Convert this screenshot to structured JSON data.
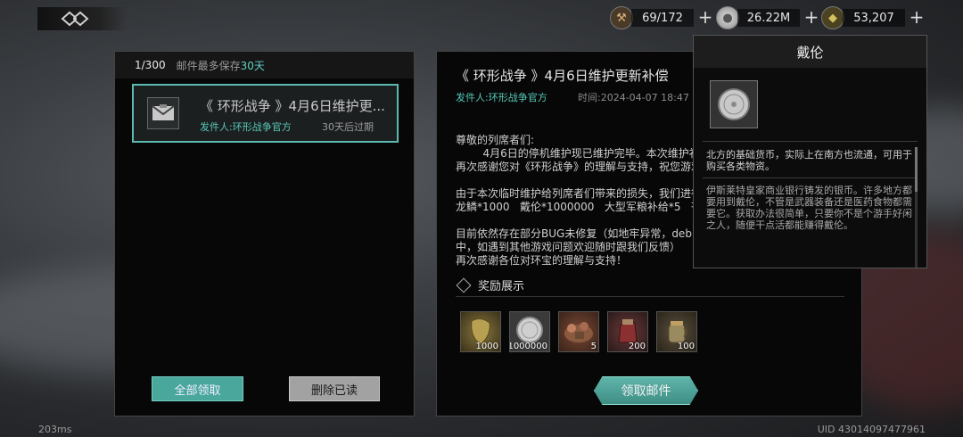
{
  "header": {
    "resources": [
      {
        "icon": "ration-icon",
        "value": "69/172"
      },
      {
        "icon": "silver-coin-icon",
        "value": "26.22M"
      },
      {
        "icon": "dragon-scale-icon",
        "value": "53,207"
      }
    ],
    "plus_label": "+"
  },
  "mail_list": {
    "count": "1/300",
    "limit_prefix": "邮件最多保存",
    "limit_days": "30天",
    "items": [
      {
        "title": "《 环形战争 》4月6日维护更...",
        "sender": "发件人:环形战争官方",
        "expiry": "30天后过期"
      }
    ],
    "claim_all_label": "全部领取",
    "delete_read_label": "删除已读"
  },
  "mail_detail": {
    "title": "《 环形战争 》4月6日维护更新补偿",
    "sender": "发件人:环形战争官方",
    "time": "时间:2024-04-07 18:47",
    "body": "尊敬的列席者们:\n        4月6日的停机维护现已维护完毕。本次维护补\n再次感谢您对《环形战争》的理解与支持，祝您游戏\n\n由于本次临时维护给列席者们带来的损失，我们进行\n龙鳞*1000   戴伦*1000000   大型军粮补给*5   苍\n\n目前依然存在部分BUG未修复（如地牢异常，deb\n中，如遇到其他游戏问题欢迎随时跟我们反馈）\n再次感谢各位对环宝的理解与支持！",
    "reward_title": "奖励展示",
    "rewards": [
      {
        "icon": "dragon-scale-icon",
        "qty": "1000"
      },
      {
        "icon": "silver-coin-icon",
        "qty": "1000000"
      },
      {
        "icon": "supply-crate-icon",
        "qty": "5"
      },
      {
        "icon": "potion-bag-icon",
        "qty": "200"
      },
      {
        "icon": "ration-jar-icon",
        "qty": "100"
      }
    ],
    "claim_label": "领取邮件"
  },
  "tooltip": {
    "title": "戴伦",
    "icon": "silver-coin-icon",
    "desc_primary": "北方的基础货币，实际上在南方也流通，可用于购买各类物资。",
    "desc_secondary": "伊斯莱特皇家商业银行铸发的银币。许多地方都要用到戴伦，不管是武器装备还是医药食物都需要它。获取办法很简单，只要你不是个游手好闲之人，随便干点活都能赚得戴伦。"
  },
  "footer": {
    "ping": "203ms",
    "uid": "UID 43014097477961"
  }
}
